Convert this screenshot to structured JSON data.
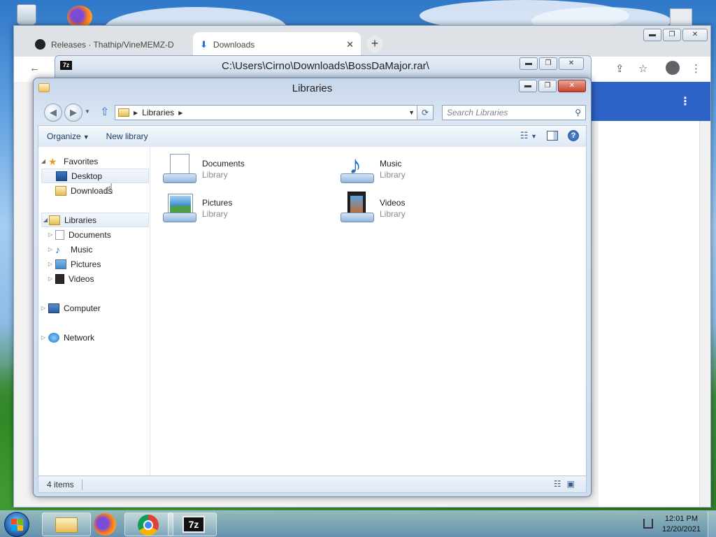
{
  "chrome": {
    "tabs": [
      {
        "label": "Releases · Thathip/VineMEMZ-D",
        "icon": "github-icon"
      },
      {
        "label": "Downloads",
        "icon": "download-icon"
      }
    ]
  },
  "sevenzip": {
    "title": "C:\\Users\\Cirno\\Downloads\\BossDaMajor.rar\\",
    "icon_text": "7z"
  },
  "explorer": {
    "title": "Libraries",
    "address": {
      "crumb": "Libraries"
    },
    "search": {
      "placeholder": "Search Libraries"
    },
    "commands": {
      "organize": "Organize",
      "new_library": "New library"
    },
    "nav": {
      "favorites": "Favorites",
      "desktop": "Desktop",
      "downloads": "Downloads",
      "libraries": "Libraries",
      "documents": "Documents",
      "music": "Music",
      "pictures": "Pictures",
      "videos": "Videos",
      "computer": "Computer",
      "network": "Network"
    },
    "libraries": [
      {
        "name": "Documents",
        "type": "Library"
      },
      {
        "name": "Music",
        "type": "Library"
      },
      {
        "name": "Pictures",
        "type": "Library"
      },
      {
        "name": "Videos",
        "type": "Library"
      }
    ],
    "status": {
      "items": "4 items"
    }
  },
  "taskbar": {
    "apps": [
      "Windows Explorer",
      "Firefox",
      "Google Chrome",
      "7-Zip"
    ],
    "sevenzip_label": "7z",
    "clock": {
      "time": "12:01 PM",
      "date": "12/20/2021"
    }
  }
}
